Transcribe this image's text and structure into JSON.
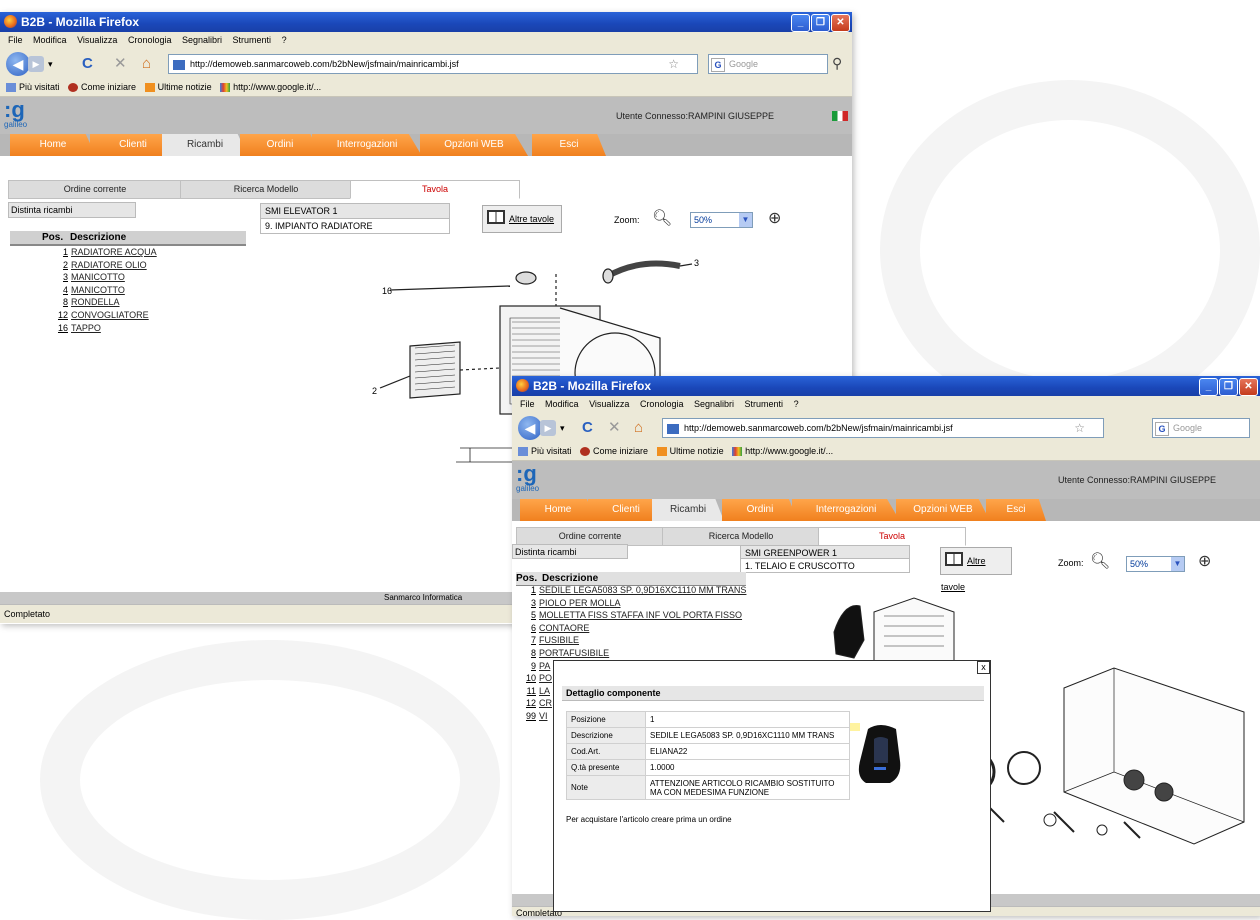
{
  "browser": {
    "title": "B2B - Mozilla Firefox",
    "menu": [
      "File",
      "Modifica",
      "Visualizza",
      "Cronologia",
      "Segnalibri",
      "Strumenti",
      "?"
    ],
    "url": "http://demoweb.sanmarcoweb.com/b2bNew/jsfmain/mainricambi.jsf",
    "search_placeholder": "Google",
    "bookmarks": [
      "Più visitati",
      "Come iniziare",
      "Ultime notizie",
      "http://www.google.it/..."
    ],
    "status": "Completato"
  },
  "app": {
    "logo_text": "galileo",
    "user": "Utente Connesso:RAMPINI GIUSEPPE",
    "tabs": [
      "Home",
      "Clienti",
      "Ricambi",
      "Ordini",
      "Interrogazioni",
      "Opzioni WEB",
      "Esci"
    ],
    "subtabs": [
      "Ordine corrente",
      "Ricerca Modello",
      "Tavola"
    ],
    "distinta_label": "Distinta ricambi",
    "altre_tavole": "Altre tavole",
    "zoom_label": "Zoom:",
    "zoom_value": "50%",
    "list_header": {
      "pos": "Pos.",
      "desc": "Descrizione"
    },
    "footer": "Sanmarco Informatica"
  },
  "window1": {
    "model": "SMI ELEVATOR 1",
    "table": "9. IMPIANTO RADIATORE",
    "parts": [
      {
        "pos": "1",
        "desc": "RADIATORE ACQUA"
      },
      {
        "pos": "2",
        "desc": "RADIATORE OLIO"
      },
      {
        "pos": "3",
        "desc": "MANICOTTO"
      },
      {
        "pos": "4",
        "desc": "MANICOTTO"
      },
      {
        "pos": "8",
        "desc": "RONDELLA"
      },
      {
        "pos": "12",
        "desc": "CONVOGLIATORE"
      },
      {
        "pos": "16",
        "desc": "TAPPO"
      }
    ],
    "callouts": [
      "16",
      "3",
      "2"
    ]
  },
  "window2": {
    "model": "SMI GREENPOWER 1",
    "table": "1. TELAIO E CRUSCOTTO",
    "parts": [
      {
        "pos": "1",
        "desc": "SEDILE LEGA5083 SP. 0,9D16XC1110 MM TRANS"
      },
      {
        "pos": "3",
        "desc": "PIOLO PER MOLLA"
      },
      {
        "pos": "5",
        "desc": "MOLLETTA FISS STAFFA INF VOL PORTA FISSO"
      },
      {
        "pos": "6",
        "desc": "CONTAORE"
      },
      {
        "pos": "7",
        "desc": "FUSIBILE"
      },
      {
        "pos": "8",
        "desc": "PORTAFUSIBILE"
      },
      {
        "pos": "9",
        "desc": "PA"
      },
      {
        "pos": "10",
        "desc": "PO"
      },
      {
        "pos": "11",
        "desc": "LA"
      },
      {
        "pos": "12",
        "desc": "CR"
      },
      {
        "pos": "99",
        "desc": "VI"
      }
    ]
  },
  "modal": {
    "close": "x",
    "title": "Dettaglio componente",
    "fields": [
      {
        "key": "Posizione",
        "value": "1"
      },
      {
        "key": "Descrizione",
        "value": "SEDILE LEGA5083 SP. 0,9D16XC1110 MM TRANS"
      },
      {
        "key": "Cod.Art.",
        "value": "ELIANA22"
      },
      {
        "key": "Q.tà presente",
        "value": "1.0000"
      },
      {
        "key": "Note",
        "value": "ATTENZIONE ARTICOLO RICAMBIO SOSTITUITO MA CON MEDESIMA FUNZIONE"
      }
    ],
    "footer_note": "Per acquistare l'articolo creare prima un ordine"
  },
  "colors": {
    "titlebar": "#1a47b8",
    "tab_orange": "#f0801e",
    "chrome": "#ece9d8",
    "app_header": "#bdbdbd",
    "active_subtab_text": "#cc0000"
  }
}
